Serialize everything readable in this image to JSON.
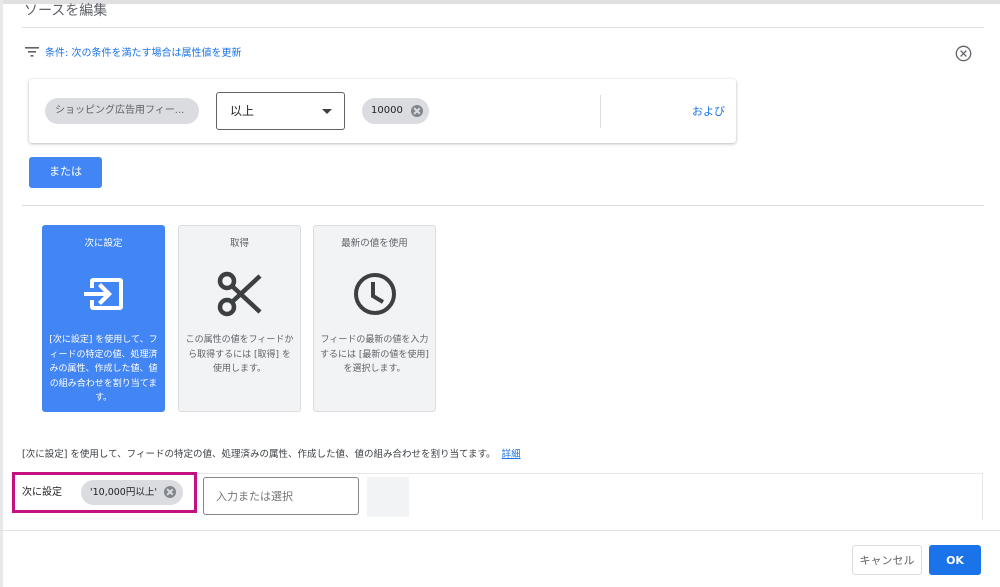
{
  "dialog": {
    "title": "ソースを編集"
  },
  "condition": {
    "label": "条件: 次の条件を満たす場合は属性値を更新",
    "attribute_chip": "ショッピング広告用フィー...",
    "operator": "以上",
    "value_chip": "10000",
    "and_label": "および",
    "or_button": "または"
  },
  "options": [
    {
      "title": "次に設定",
      "icon": "set-arrow-icon",
      "desc": "[次に設定] を使用して、フィードの特定の値、処理済みの属性、作成した値、値の組み合わせを割り当てます。",
      "active": true
    },
    {
      "title": "取得",
      "icon": "scissors-icon",
      "desc": "この属性の値をフィードから取得するには [取得] を使用します。",
      "active": false
    },
    {
      "title": "最新の値を使用",
      "icon": "clock-icon",
      "desc": "フィードの最新の値を入力するには [最新の値を使用] を選択します。",
      "active": false
    }
  ],
  "info": {
    "text": "[次に設定] を使用して、フィードの特定の値、処理済みの属性、作成した値、値の組み合わせを割り当てます。",
    "link": "詳細"
  },
  "set_to": {
    "label": "次に設定",
    "chip": "'10,000円以上'",
    "input_placeholder": "入力または選択"
  },
  "footer": {
    "cancel": "キャンセル",
    "ok": "OK"
  },
  "colors": {
    "accent": "#4285f4",
    "link": "#1a73e8",
    "highlight": "#c3117f"
  }
}
